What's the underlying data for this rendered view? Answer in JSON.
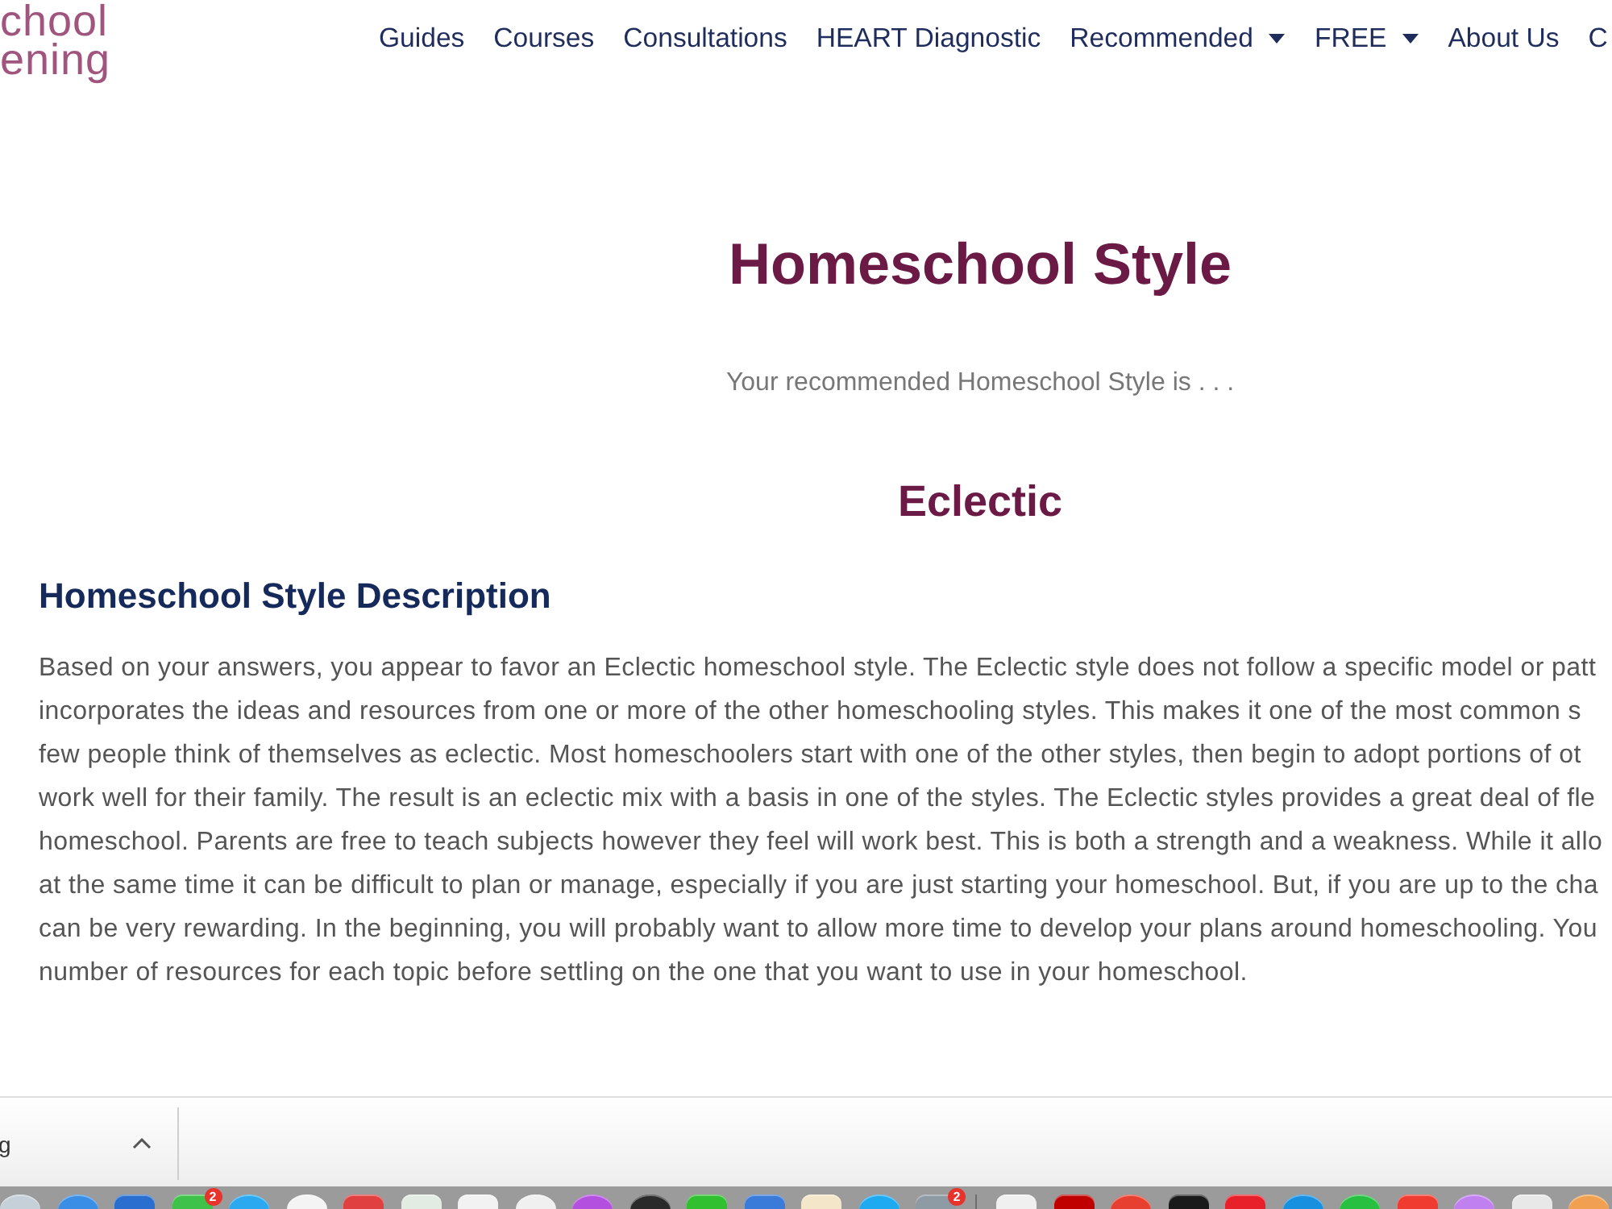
{
  "header": {
    "logo_lines": [
      "chool",
      "ening"
    ],
    "nav": [
      {
        "label": "Guides",
        "dropdown": false
      },
      {
        "label": "Courses",
        "dropdown": false
      },
      {
        "label": "Consultations",
        "dropdown": false
      },
      {
        "label": "HEART Diagnostic",
        "dropdown": false
      },
      {
        "label": "Recommended",
        "dropdown": true
      },
      {
        "label": "FREE",
        "dropdown": true
      },
      {
        "label": "About Us",
        "dropdown": false
      },
      {
        "label": "C",
        "dropdown": false
      }
    ]
  },
  "result": {
    "title": "Homeschool Style",
    "intro": "Your recommended Homeschool Style is . . .",
    "style_name": "Eclectic"
  },
  "description": {
    "heading": "Homeschool Style Description",
    "lines": [
      "Based on your answers, you appear to favor an Eclectic homeschool style. The Eclectic style does not follow a specific model or patt",
      "incorporates the ideas and resources from one or more of the other homeschooling styles. This makes it one of the most common s",
      "few people think of themselves as eclectic. Most homeschoolers start with one of the other styles, then begin to adopt portions of ot",
      "work well for their family. The result is an eclectic mix with a basis in one of the styles. The Eclectic styles provides a great deal of fle",
      "homeschool. Parents are free to teach subjects however they feel will work best. This is both a strength and a weakness. While it allo",
      "at the same time it can be difficult to plan or manage, especially if you are just starting your homeschool. But, if you are up to the cha",
      "can be very rewarding. In the beginning, you will probably want to allow more time to develop your plans around homeschooling. You",
      "number of resources for each topic before settling on the one that you want to use in your homeschool."
    ]
  },
  "downloads_bar": {
    "filename": "g"
  },
  "dock": {
    "apps": [
      {
        "kind": "round",
        "color": "#c5d0d8"
      },
      {
        "kind": "round",
        "color": "#3a8ee6"
      },
      {
        "kind": "square",
        "color": "#2a6fd0"
      },
      {
        "kind": "square",
        "color": "#3fc24a",
        "badge": "2"
      },
      {
        "kind": "round",
        "color": "#2aa8f0"
      },
      {
        "kind": "round",
        "color": "#f4f4f4"
      },
      {
        "kind": "square",
        "color": "#e04040"
      },
      {
        "kind": "square",
        "color": "#e3ece3"
      },
      {
        "kind": "square",
        "color": "#f2f2f2"
      },
      {
        "kind": "round",
        "color": "#f0f0f0"
      },
      {
        "kind": "round",
        "color": "#b450e0"
      },
      {
        "kind": "round",
        "color": "#2a2a2a"
      },
      {
        "kind": "square",
        "color": "#30c030"
      },
      {
        "kind": "square",
        "color": "#3a7ad8"
      },
      {
        "kind": "square",
        "color": "#f4e6c8"
      },
      {
        "kind": "round",
        "color": "#1eaaf0"
      },
      {
        "kind": "square",
        "color": "#8e9aa4",
        "badge": "2"
      }
    ],
    "documents": [
      {
        "kind": "square",
        "color": "#f0f0f0"
      },
      {
        "kind": "square",
        "color": "#c00000"
      },
      {
        "kind": "round",
        "color": "#e84030"
      },
      {
        "kind": "square",
        "color": "#1a1a1a"
      },
      {
        "kind": "square",
        "color": "#e8202a"
      },
      {
        "kind": "round",
        "color": "#1890e0"
      },
      {
        "kind": "round",
        "color": "#28c040"
      },
      {
        "kind": "square",
        "color": "#f03c30"
      },
      {
        "kind": "round",
        "color": "#c080f0"
      },
      {
        "kind": "square",
        "color": "#e8e8e8"
      },
      {
        "kind": "round",
        "color": "#f0a050"
      }
    ]
  }
}
